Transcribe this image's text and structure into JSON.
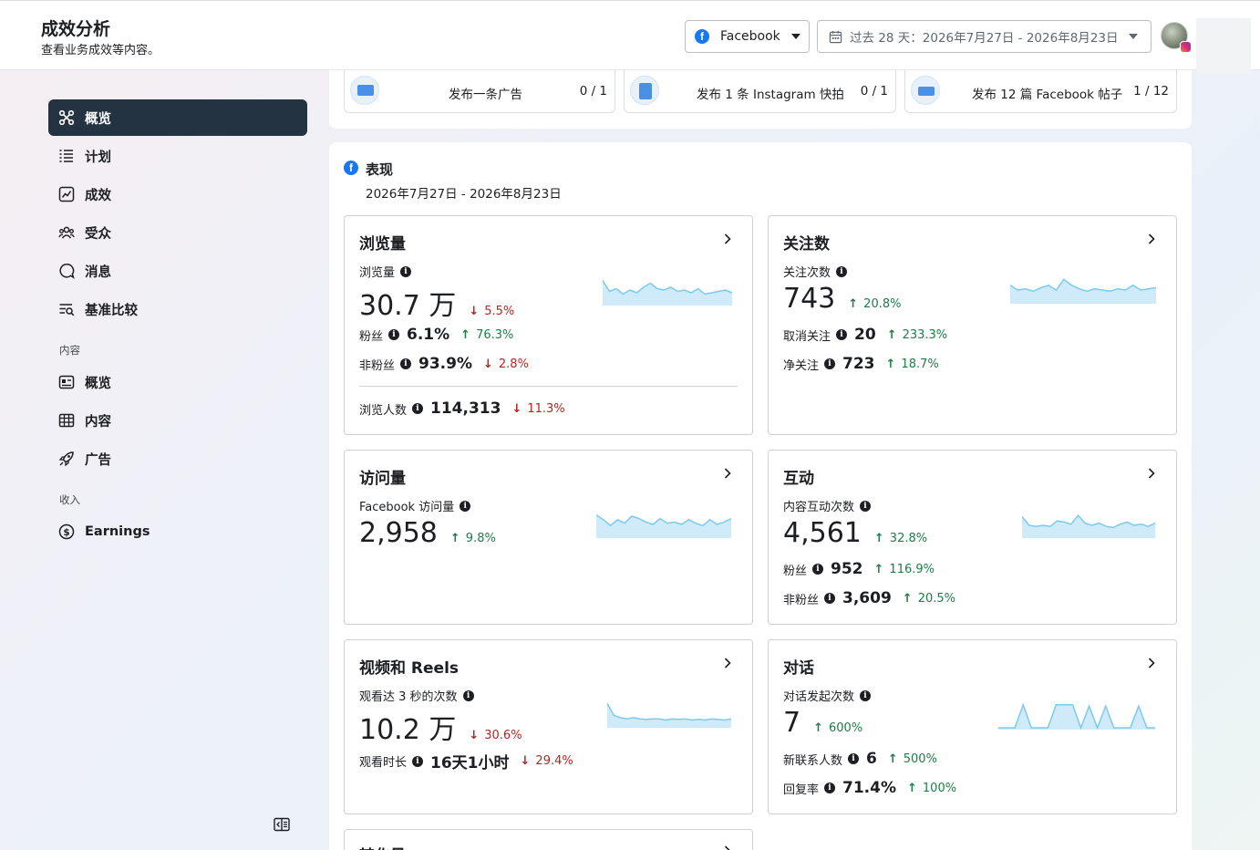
{
  "header": {
    "title": "成效分析",
    "subtitle": "查看业务成效等内容。",
    "platform": "Facebook",
    "date_range": "过去 28 天：2026年7月27日 - 2026年8月23日"
  },
  "sidebar": {
    "items": [
      {
        "label": "概览",
        "icon": "overview-icon",
        "active": true
      },
      {
        "label": "计划",
        "icon": "list-icon"
      },
      {
        "label": "成效",
        "icon": "line-chart-icon"
      },
      {
        "label": "受众",
        "icon": "people-icon"
      },
      {
        "label": "消息",
        "icon": "chat-icon"
      },
      {
        "label": "基准比较",
        "icon": "benchmark-icon"
      }
    ],
    "section_content": "内容",
    "content_items": [
      {
        "label": "概览",
        "icon": "content-overview-icon"
      },
      {
        "label": "内容",
        "icon": "table-icon"
      },
      {
        "label": "广告",
        "icon": "rocket-icon"
      }
    ],
    "section_income": "收入",
    "income_items": [
      {
        "label": "Earnings",
        "icon": "dollar-icon"
      }
    ]
  },
  "tasks": [
    {
      "label": "发布一条广告",
      "count": "0 / 1"
    },
    {
      "label": "发布 1 条 Instagram 快拍",
      "count": "0 / 1"
    },
    {
      "label": "发布 12 篇 Facebook 帖子",
      "count": "1 / 12"
    }
  ],
  "performance": {
    "title": "表现",
    "date": "2026年7月27日 - 2026年8月23日"
  },
  "cards": {
    "views": {
      "title": "浏览量",
      "metric_label": "浏览量",
      "value": "30.7 万",
      "delta": "5.5%",
      "rows": [
        {
          "label": "粉丝",
          "value": "6.1%",
          "delta": "76.3%"
        },
        {
          "label": "非粉丝",
          "value": "93.9%",
          "delta": "2.8%"
        }
      ],
      "footer": {
        "label": "浏览人数",
        "value": "114,313",
        "delta": "11.3%"
      },
      "trend": [
        0.85,
        0.45,
        0.55,
        0.35,
        0.5,
        0.4,
        0.6,
        0.75,
        0.55,
        0.5,
        0.6,
        0.45,
        0.5,
        0.4,
        0.55,
        0.35,
        0.4,
        0.45,
        0.5,
        0.4
      ]
    },
    "follows": {
      "title": "关注数",
      "metric_label": "关注次数",
      "value": "743",
      "delta": "20.8%",
      "rows": [
        {
          "label": "取消关注",
          "value": "20",
          "delta": "233.3%"
        },
        {
          "label": "净关注",
          "value": "723",
          "delta": "18.7%"
        }
      ],
      "trend": [
        0.7,
        0.5,
        0.55,
        0.45,
        0.6,
        0.7,
        0.5,
        0.95,
        0.7,
        0.55,
        0.45,
        0.55,
        0.5,
        0.45,
        0.55,
        0.5,
        0.7,
        0.5,
        0.55,
        0.6
      ]
    },
    "visits": {
      "title": "访问量",
      "metric_label": "Facebook 访问量",
      "value": "2,958",
      "delta": "9.8%",
      "trend": [
        0.9,
        0.7,
        0.45,
        0.7,
        0.55,
        0.85,
        0.75,
        0.6,
        0.5,
        0.75,
        0.55,
        0.6,
        0.5,
        0.7,
        0.55,
        0.45,
        0.7,
        0.5,
        0.6,
        0.75
      ]
    },
    "engagement": {
      "title": "互动",
      "metric_label": "内容互动次数",
      "value": "4,561",
      "delta": "32.8%",
      "rows": [
        {
          "label": "粉丝",
          "value": "952",
          "delta": "116.9%"
        },
        {
          "label": "非粉丝",
          "value": "3,609",
          "delta": "20.5%"
        }
      ],
      "trend": [
        0.9,
        0.5,
        0.45,
        0.5,
        0.45,
        0.7,
        0.65,
        0.55,
        0.95,
        0.6,
        0.5,
        0.6,
        0.45,
        0.4,
        0.55,
        0.65,
        0.5,
        0.55,
        0.45,
        0.6
      ]
    },
    "video": {
      "title": "视频和 Reels",
      "metric_label": "观看达 3 秒的次数",
      "value": "10.2 万",
      "delta": "30.6%",
      "rows": [
        {
          "label": "观看时长",
          "value": "16天1小时",
          "delta": "29.4%"
        }
      ],
      "trend": [
        0.95,
        0.45,
        0.35,
        0.3,
        0.35,
        0.3,
        0.28,
        0.3,
        0.3,
        0.25,
        0.3,
        0.28,
        0.3,
        0.25,
        0.28,
        0.25,
        0.3,
        0.28,
        0.25,
        0.3
      ]
    },
    "conversations": {
      "title": "对话",
      "metric_label": "对话发起次数",
      "value": "7",
      "delta": "600%",
      "rows": [
        {
          "label": "新联系人数",
          "value": "6",
          "delta": "500%"
        },
        {
          "label": "回复率",
          "value": "71.4%",
          "delta": "100%"
        }
      ],
      "trend": [
        0,
        0,
        0,
        0.9,
        0,
        0,
        0,
        0.9,
        0.9,
        0.9,
        0,
        0.85,
        0,
        0.85,
        0,
        0,
        0,
        0.85,
        0,
        0
      ]
    },
    "partial": {
      "title": "转化量"
    }
  },
  "colors": {
    "accent": "#1877f2",
    "sidebar_active": "#243341",
    "up": "#1e7d46",
    "down": "#b3261e",
    "spark_fill": "#cfeaf8",
    "spark_line": "#7ccaf0"
  }
}
